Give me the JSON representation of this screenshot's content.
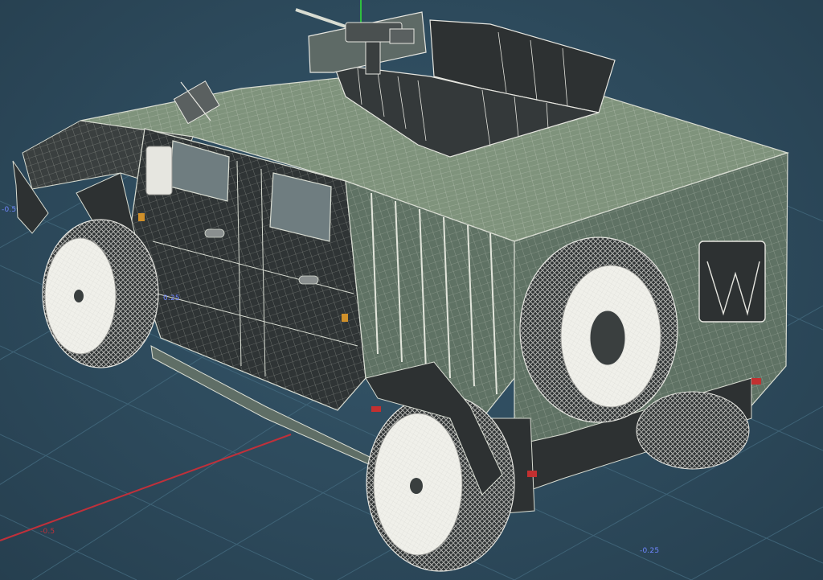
{
  "viewport": {
    "grid_labels": {
      "center": "0.25",
      "bottom_right": "-0.25",
      "left_edge": "-0.5",
      "red_axis": "-0.5"
    },
    "colors": {
      "background": "#2c4a5c",
      "grid_line": "#3f6274",
      "x_axis": "#c0303a",
      "y_axis": "#2fbf3f",
      "label_blue": "#6f86ff",
      "mesh_body": "#5f7264",
      "mesh_top": "#7f937c",
      "mesh_dark": "#2d3132",
      "wire": "#d8dcd2",
      "tire_wire": "#e5e5e0"
    },
    "object": "armored-vehicle-wireframe"
  }
}
